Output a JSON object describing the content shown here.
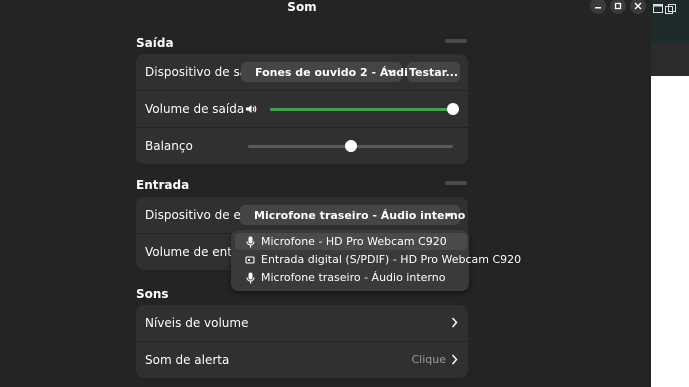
{
  "window": {
    "title": "Som"
  },
  "colors": {
    "accent": "#3fa34d",
    "surface": "#303030",
    "background": "#242424"
  },
  "output": {
    "section_title": "Saída",
    "device_label": "Dispositivo de saída",
    "device_value": "Fones de ouvido 2 - Áudio i...",
    "device_icon": "headphones-icon",
    "test_button": "Testar...",
    "volume_label": "Volume de saída",
    "volume_level": 1.0,
    "balance_label": "Balanço",
    "balance_level": 0.5
  },
  "input": {
    "section_title": "Entrada",
    "device_label": "Dispositivo de entrada",
    "device_value": "Microfone traseiro - Áudio interno",
    "device_icon": "microphone-icon",
    "volume_label": "Volume de entrada",
    "options": [
      {
        "label": "Microfone - HD Pro Webcam C920",
        "icon": "microphone-icon",
        "highlighted": true
      },
      {
        "label": "Entrada digital (S/PDIF) - HD Pro Webcam C920",
        "icon": "digital-input-icon",
        "highlighted": false
      },
      {
        "label": "Microfone traseiro - Áudio interno",
        "icon": "microphone-icon",
        "highlighted": false
      }
    ]
  },
  "sounds": {
    "section_title": "Sons",
    "volume_levels_label": "Níveis de volume",
    "alert_label": "Som de alerta",
    "alert_value": "Clique"
  }
}
